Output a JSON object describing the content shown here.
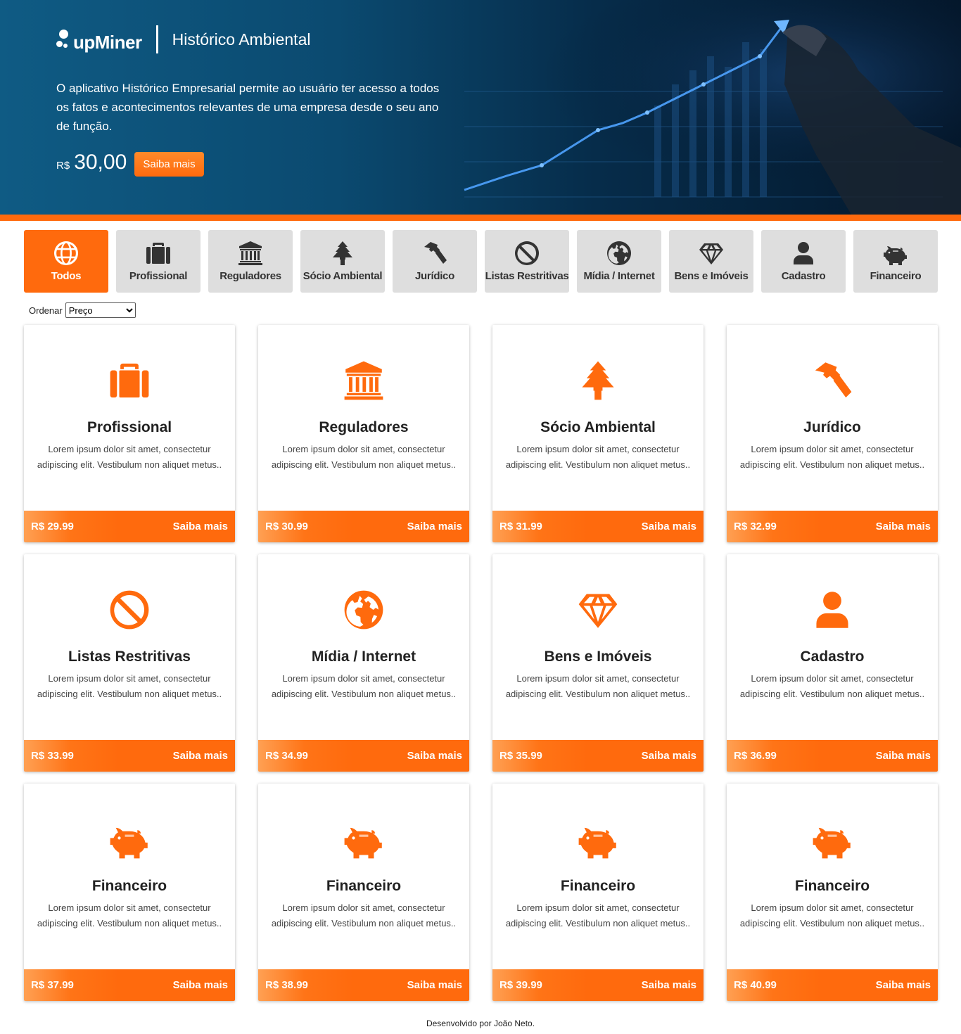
{
  "hero": {
    "logo_text": "upMiner",
    "app_title": "Histórico Ambiental",
    "description": "O aplicativo Histórico Empresarial permite ao usuário ter acesso a todos os fatos e acontecimentos relevantes de uma empresa desde o seu ano de função.",
    "currency": "R$",
    "price": "30,00",
    "cta_label": "Saiba mais"
  },
  "tabs": [
    {
      "label": "Todos",
      "icon": "globe-icon",
      "active": true
    },
    {
      "label": "Profissional",
      "icon": "briefcase-icon"
    },
    {
      "label": "Reguladores",
      "icon": "bank-icon"
    },
    {
      "label": "Sócio Ambiental",
      "icon": "tree-icon"
    },
    {
      "label": "Jurídico",
      "icon": "hammer-icon"
    },
    {
      "label": "Listas Restritivas",
      "icon": "ban-icon"
    },
    {
      "label": "Mídia / Internet",
      "icon": "earth-icon"
    },
    {
      "label": "Bens e Imóveis",
      "icon": "diamond-icon"
    },
    {
      "label": "Cadastro",
      "icon": "user-icon"
    },
    {
      "label": "Financeiro",
      "icon": "piggy-bank-icon"
    }
  ],
  "sort": {
    "label": "Ordenar",
    "selected": "Preço"
  },
  "cards": [
    {
      "title": "Profissional",
      "icon": "briefcase-icon",
      "description": "Lorem ipsum dolor sit amet, consectetur adipiscing elit. Vestibulum non aliquet metus..",
      "price": "R$ 29.99",
      "cta": "Saiba mais"
    },
    {
      "title": "Reguladores",
      "icon": "bank-icon",
      "description": "Lorem ipsum dolor sit amet, consectetur adipiscing elit. Vestibulum non aliquet metus..",
      "price": "R$ 30.99",
      "cta": "Saiba mais"
    },
    {
      "title": "Sócio Ambiental",
      "icon": "tree-icon",
      "description": "Lorem ipsum dolor sit amet, consectetur adipiscing elit. Vestibulum non aliquet metus..",
      "price": "R$ 31.99",
      "cta": "Saiba mais"
    },
    {
      "title": "Jurídico",
      "icon": "hammer-icon",
      "description": "Lorem ipsum dolor sit amet, consectetur adipiscing elit. Vestibulum non aliquet metus..",
      "price": "R$ 32.99",
      "cta": "Saiba mais"
    },
    {
      "title": "Listas Restritivas",
      "icon": "ban-icon",
      "description": "Lorem ipsum dolor sit amet, consectetur adipiscing elit. Vestibulum non aliquet metus..",
      "price": "R$ 33.99",
      "cta": "Saiba mais"
    },
    {
      "title": "Mídia / Internet",
      "icon": "earth-icon",
      "description": "Lorem ipsum dolor sit amet, consectetur adipiscing elit. Vestibulum non aliquet metus..",
      "price": "R$ 34.99",
      "cta": "Saiba mais"
    },
    {
      "title": "Bens e Imóveis",
      "icon": "diamond-icon",
      "description": "Lorem ipsum dolor sit amet, consectetur adipiscing elit. Vestibulum non aliquet metus..",
      "price": "R$ 35.99",
      "cta": "Saiba mais"
    },
    {
      "title": "Cadastro",
      "icon": "user-icon",
      "description": "Lorem ipsum dolor sit amet, consectetur adipiscing elit. Vestibulum non aliquet metus..",
      "price": "R$ 36.99",
      "cta": "Saiba mais"
    },
    {
      "title": "Financeiro",
      "icon": "piggy-bank-icon",
      "description": "Lorem ipsum dolor sit amet, consectetur adipiscing elit. Vestibulum non aliquet metus..",
      "price": "R$ 37.99",
      "cta": "Saiba mais"
    },
    {
      "title": "Financeiro",
      "icon": "piggy-bank-icon",
      "description": "Lorem ipsum dolor sit amet, consectetur adipiscing elit. Vestibulum non aliquet metus..",
      "price": "R$ 38.99",
      "cta": "Saiba mais"
    },
    {
      "title": "Financeiro",
      "icon": "piggy-bank-icon",
      "description": "Lorem ipsum dolor sit amet, consectetur adipiscing elit. Vestibulum non aliquet metus..",
      "price": "R$ 39.99",
      "cta": "Saiba mais"
    },
    {
      "title": "Financeiro",
      "icon": "piggy-bank-icon",
      "description": "Lorem ipsum dolor sit amet, consectetur adipiscing elit. Vestibulum non aliquet metus..",
      "price": "R$ 40.99",
      "cta": "Saiba mais"
    }
  ],
  "footer": {
    "text": "Desenvolvido por João Neto."
  },
  "colors": {
    "accent": "#ff6a0d",
    "hero_dark": "#04172b",
    "hero_light": "#0f5b84",
    "tab_bg": "#dedede"
  }
}
